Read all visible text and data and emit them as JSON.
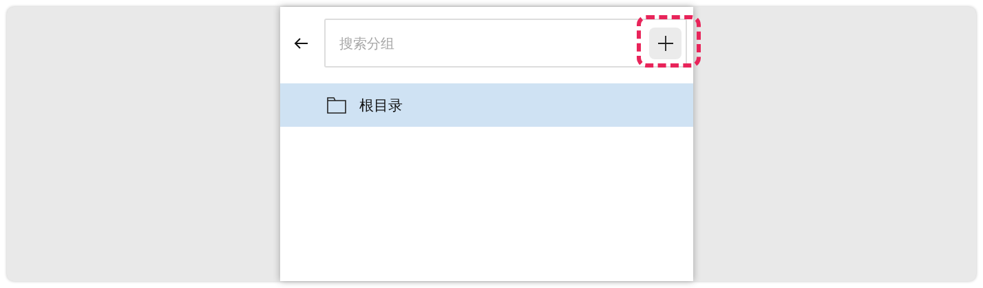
{
  "header": {
    "back_button": {
      "kind": "arrow"
    },
    "search": {
      "placeholder": "搜索分组"
    },
    "add_button": {
      "highlighted": true
    }
  },
  "tree": {
    "items": [
      {
        "label": "根目录",
        "kind": "folder",
        "selected": true
      }
    ]
  }
}
